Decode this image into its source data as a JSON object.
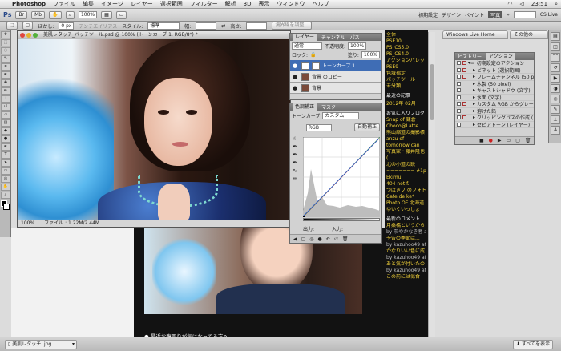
{
  "menubar": {
    "app_name": "Photoshop",
    "items": [
      "ファイル",
      "編集",
      "イメージ",
      "レイヤー",
      "選択範囲",
      "フィルター",
      "解析",
      "3D",
      "表示",
      "ウィンドウ",
      "ヘルプ"
    ],
    "clock": "23:51",
    "workspaces": [
      "初期設定",
      "デザイン",
      "ペイント",
      "写真"
    ],
    "cs_live": "CS Live"
  },
  "options": {
    "zoom": "100%",
    "feather_label": "ぼかし:",
    "feather_value": "0 px",
    "antialias": "アンチエイリアス",
    "style_label": "スタイル:",
    "style_value": "標準",
    "width_label": "幅:",
    "height_label": "高さ:",
    "refine": "境界線を調整..."
  },
  "document": {
    "title": "美肌レタッチ_パッチツール.psd @ 100% (トーンカーブ 1, RGB/8*) *",
    "zoom": "100%",
    "file_info": "ファイル : 1.22M/2.44M"
  },
  "layers_panel": {
    "tabs": [
      "レイヤー",
      "チャンネル",
      "パス"
    ],
    "blend_mode": "通常",
    "opacity_label": "不透明度:",
    "opacity": "100%",
    "lock_label": "ロック:",
    "fill_label": "塗り:",
    "fill": "100%",
    "layers": [
      "トーンカーブ 1",
      "背景 のコピー",
      "背景"
    ]
  },
  "adjust_panel": {
    "tabs": [
      "色調補正",
      "マスク"
    ],
    "title": "トーンカーブ",
    "preset": "カスタム",
    "channel": "RGB",
    "auto_button": "自動補正",
    "output_label": "出力:",
    "input_label": "入力:"
  },
  "actions_panel": {
    "tabs": [
      "ヒストリー",
      "アクション"
    ],
    "set_name": "初期設定のアクション",
    "items": [
      "ビネット (選択範囲)",
      "フレームチャンネル (50 pixel)",
      "木製 (50 pixel)",
      "キャストシャドウ (文字)",
      "水面 (文字)",
      "カスタム RGB からグレー...",
      "溶けた鉛",
      "クリッピングパスの作成 (...",
      "セピアトーン (レイヤー)"
    ]
  },
  "browser": {
    "tabs": [
      "Windows Live Home",
      "その他の"
    ],
    "sidebar": [
      "全体",
      "PSE10",
      "PS_CS5.0",
      "PS_CS4.0",
      "アクションパレット",
      "PSE9",
      "色域指定",
      "パッチツール",
      "未分類"
    ],
    "recent_title": "最近の記事",
    "month": "2012年 02月",
    "favorites": "お気に入りブログ",
    "links": [
      "Snap of 鎌倉",
      "Choco@Latte",
      "熊山縮道の撮影帳",
      "anzu of",
      "tomorrow can",
      "写真家・藤井隆也",
      "(...",
      "北の小道の鋭",
      "======= #1p",
      "Ekimu",
      "404 not f..",
      "つばきブ のフォト",
      "Cafe de ke*",
      "Photo OF 北海道",
      "ゆいくいっしょ"
    ],
    "comments_title": "最新のコメント",
    "comments": [
      "月桑橋というから",
      "by 灰やかなき者 at",
      "予告の季節は...",
      "by kazuhoo49 at",
      "かなりいい色に成",
      "by kazuhoo49 at",
      "あと気が付いたの",
      "by kazuhoo49 at",
      "この前には似合"
    ],
    "article_headline": "最近お腹周りが気になってる方へ",
    "open_all": "すべてを表示"
  },
  "taskbar": {
    "file": "美肌レタッチ .jpg"
  }
}
